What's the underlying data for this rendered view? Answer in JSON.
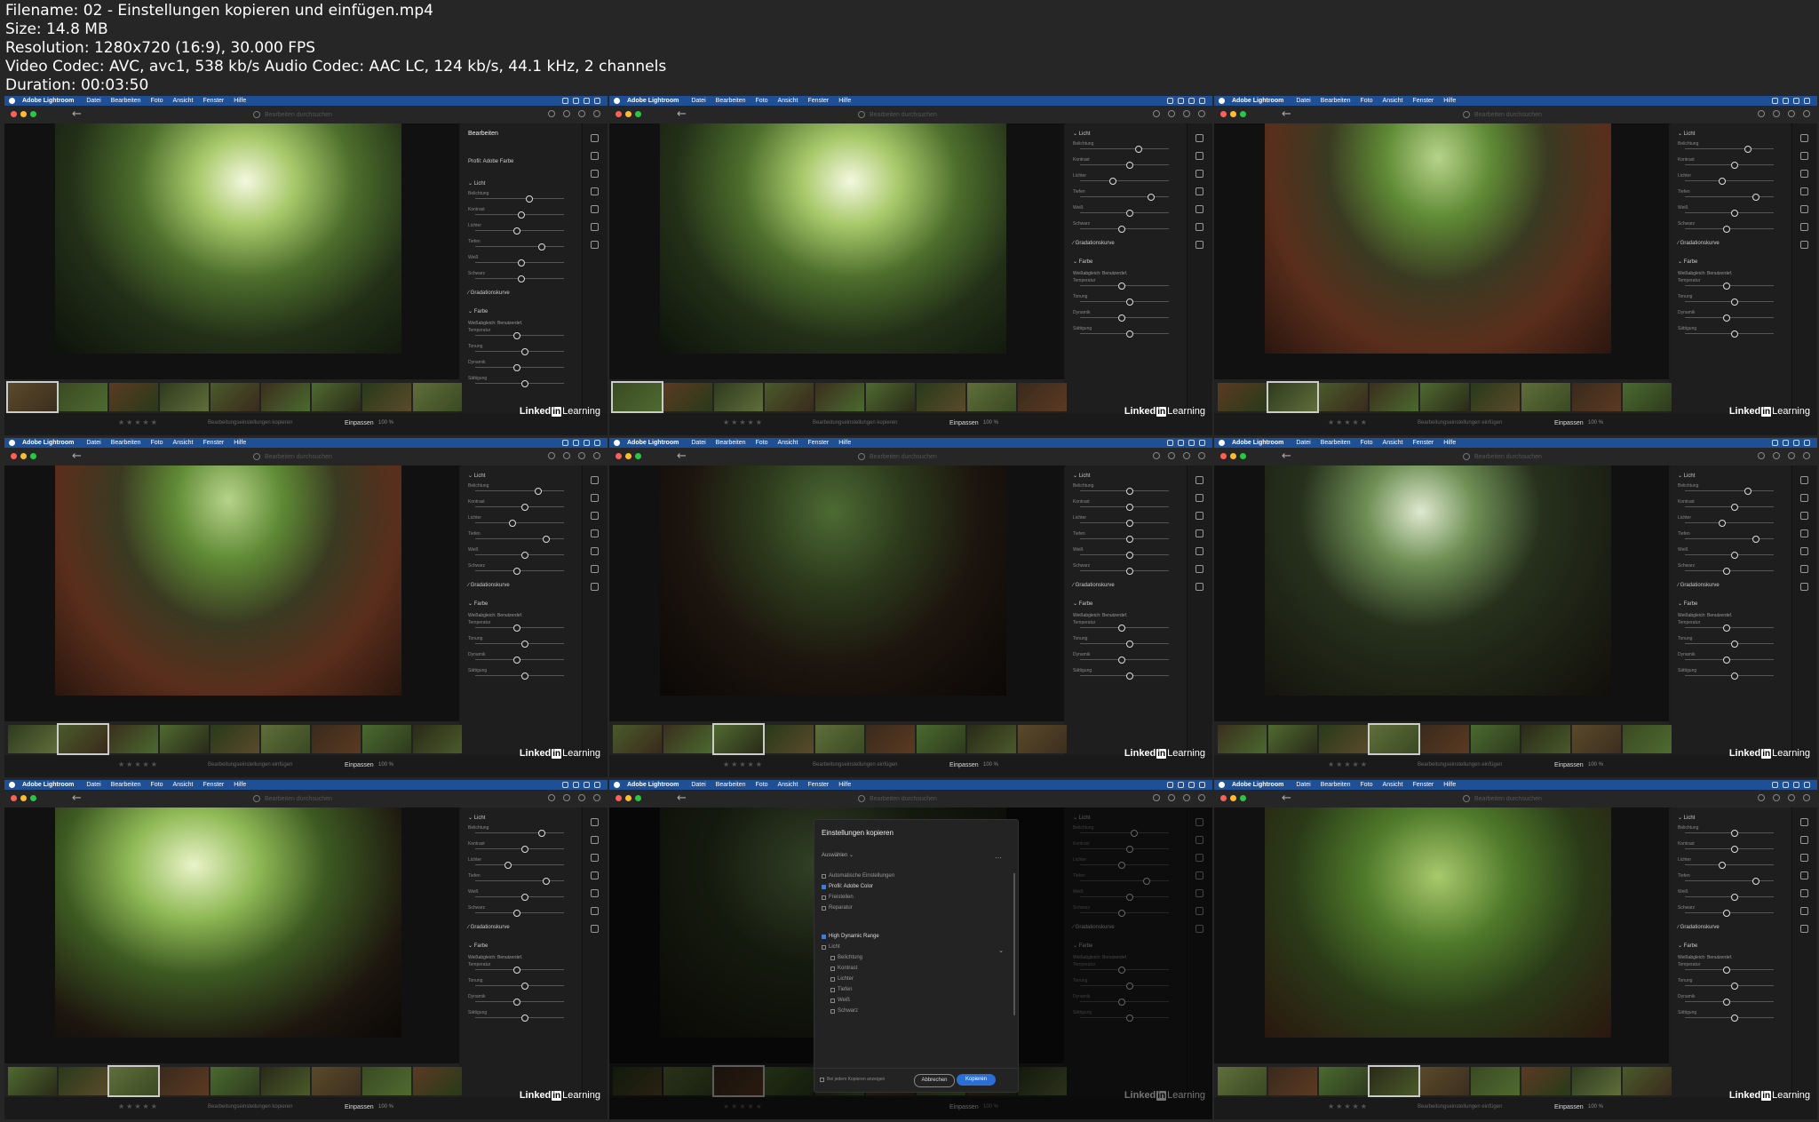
{
  "meta": [
    "Filename: 02 - Einstellungen kopieren und einfügen.mp4",
    "Size: 14.8 MB",
    "Resolution: 1280x720 (16:9), 30.000 FPS",
    "Video Codec: AVC, avc1, 538 kb/s Audio Codec: AAC LC, 124 kb/s, 44.1 kHz, 2 channels",
    "Duration: 00:03:50"
  ],
  "app": {
    "name": "Adobe Lightroom",
    "menus": [
      "Datei",
      "Bearbeiten",
      "Foto",
      "Ansicht",
      "Fenster",
      "Hilfe"
    ],
    "search_placeholder": "Bearbeiten durchsuchen",
    "panel_title": "Bearbeiten",
    "profile_label": "Profil: Adobe Farbe",
    "section_light": "Licht",
    "section_color": "Farbe",
    "curve_label": "Gradationskurve",
    "wb_label": "Weißabgleich: Benutzerdef.",
    "sliders": [
      "Belichtung",
      "Kontrast",
      "Lichter",
      "Tiefen",
      "Weiß",
      "Schwarz"
    ],
    "color_sliders": [
      "Temperatur",
      "Tonung",
      "Dynamik",
      "Sättigung"
    ],
    "stars": "★★★★★",
    "fit_label": "Einpassen",
    "zoom_label": "100 %",
    "logo_a": "Linked",
    "logo_in": "in",
    "logo_b": "Learning",
    "colors": {
      "menubar": "#1f4f94",
      "accent": "#2a6fd6"
    }
  },
  "tiles": [
    {
      "action": "Bearbeitungseinstellungen kopieren",
      "scene": "riders-rock",
      "sel": 0,
      "knobs": [
        0.6,
        0.5,
        0.45,
        0.75,
        0.5,
        0.5
      ]
    },
    {
      "action": "Bearbeitungseinstellungen kopieren",
      "scene": "riders-rock",
      "sel": 0,
      "knobs": [
        0.65,
        0.55,
        0.35,
        0.8,
        0.55,
        0.45
      ]
    },
    {
      "action": "Bearbeitungseinstellungen einfügen",
      "scene": "trail",
      "sel": 1,
      "knobs": [
        0.7,
        0.55,
        0.4,
        0.8,
        0.55,
        0.45
      ]
    },
    {
      "action": "Bearbeitungseinstellungen einfügen",
      "scene": "trail",
      "sel": 1,
      "knobs": [
        0.7,
        0.55,
        0.4,
        0.8,
        0.55,
        0.45
      ]
    },
    {
      "action": "Bearbeitungseinstellungen einfügen",
      "scene": "dark-trail",
      "sel": 2,
      "knobs": [
        0.55,
        0.55,
        0.55,
        0.55,
        0.55,
        0.55
      ]
    },
    {
      "action": "Bearbeitungseinstellungen einfügen",
      "scene": "dark-rider",
      "sel": 3,
      "knobs": [
        0.7,
        0.55,
        0.4,
        0.8,
        0.55,
        0.45
      ]
    },
    {
      "action": "Bearbeitungseinstellungen kopieren",
      "scene": "forest-rider",
      "sel": 2,
      "knobs": [
        0.75,
        0.55,
        0.35,
        0.8,
        0.55,
        0.45
      ]
    },
    {
      "action": "",
      "scene": "dialog",
      "sel": 2,
      "knobs": [
        0.6,
        0.55,
        0.45,
        0.75,
        0.55,
        0.45
      ]
    },
    {
      "action": "Bearbeitungseinstellungen einfügen",
      "scene": "green-forest",
      "sel": 3,
      "knobs": [
        0.55,
        0.55,
        0.4,
        0.8,
        0.55,
        0.45
      ]
    }
  ],
  "dialog": {
    "title": "Einstellungen kopieren",
    "select": "Auswählen ⌄",
    "more": "…",
    "options": [
      {
        "label": "Automatische Einstellungen",
        "on": false,
        "indent": 0
      },
      {
        "label": "Profil: Adobe Color",
        "on": true,
        "indent": 0
      },
      {
        "label": "Freistellen",
        "on": false,
        "indent": 0
      },
      {
        "label": "Reparatur",
        "on": false,
        "indent": 0
      },
      {
        "label": "High Dynamic Range",
        "on": true,
        "indent": 0
      },
      {
        "label": "Licht",
        "on": false,
        "indent": 0
      },
      {
        "label": "Belichtung",
        "on": false,
        "indent": 1
      },
      {
        "label": "Kontrast",
        "on": false,
        "indent": 1
      },
      {
        "label": "Lichter",
        "on": false,
        "indent": 1
      },
      {
        "label": "Tiefen",
        "on": false,
        "indent": 1
      },
      {
        "label": "Weiß",
        "on": false,
        "indent": 1
      },
      {
        "label": "Schwarz",
        "on": false,
        "indent": 1
      }
    ],
    "check_label": "Bei jedem Kopieren anzeigen",
    "cancel": "Abbrechen",
    "copy": "Kopieren"
  }
}
